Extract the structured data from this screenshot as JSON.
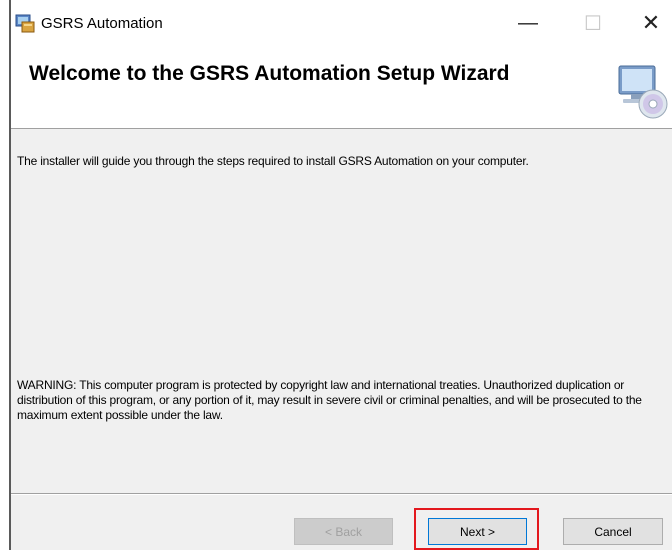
{
  "window": {
    "title": "GSRS Automation",
    "minimize_glyph": "—",
    "maximize_glyph": "☐",
    "close_glyph": "✕"
  },
  "header": {
    "title": "Welcome to the GSRS Automation Setup Wizard",
    "icon": "computer-cd-icon"
  },
  "content": {
    "intro": "The installer will guide you through the steps required to install GSRS Automation on your computer.",
    "warning": "WARNING: This computer program is protected by copyright law and international treaties. Unauthorized duplication or distribution of this program, or any portion of it, may result in severe civil or criminal penalties, and will be prosecuted to the maximum extent possible under the law."
  },
  "buttons": {
    "back": "< Back",
    "next": "Next >",
    "cancel": "Cancel"
  },
  "colors": {
    "highlight": "#e3181e",
    "focus_border": "#0078d7"
  }
}
